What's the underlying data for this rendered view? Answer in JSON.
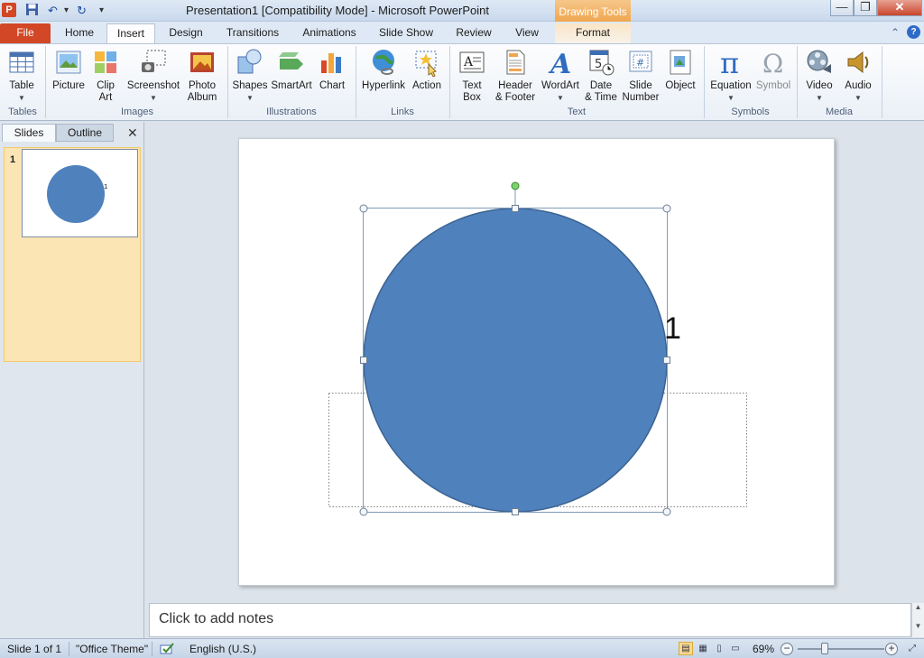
{
  "window": {
    "title": "Presentation1 [Compatibility Mode]  -  Microsoft PowerPoint",
    "app_logo": "P",
    "contextual_group": "Drawing Tools",
    "controls": {
      "minimize": "—",
      "restore": "❐",
      "close": "✕"
    }
  },
  "quick_access": {
    "save": "save-icon",
    "undo": "↶",
    "undo_dropdown": "▾",
    "redo": "↻",
    "customize": "▾"
  },
  "tabs": [
    {
      "label": "File"
    },
    {
      "label": "Home"
    },
    {
      "label": "Insert",
      "active": true
    },
    {
      "label": "Design"
    },
    {
      "label": "Transitions"
    },
    {
      "label": "Animations"
    },
    {
      "label": "Slide Show"
    },
    {
      "label": "Review"
    },
    {
      "label": "View"
    },
    {
      "label": "Format"
    }
  ],
  "ribbon": {
    "groups": {
      "tables": "Tables",
      "images": "Images",
      "illustrations": "Illustrations",
      "links": "Links",
      "text": "Text",
      "symbols": "Symbols",
      "media": "Media"
    },
    "buttons": {
      "table": "Table",
      "picture": "Picture",
      "clip_art_1": "Clip",
      "clip_art_2": "Art",
      "screenshot": "Screenshot",
      "photo_album_1": "Photo",
      "photo_album_2": "Album",
      "shapes": "Shapes",
      "smartart": "SmartArt",
      "chart": "Chart",
      "hyperlink": "Hyperlink",
      "action": "Action",
      "text_box_1": "Text",
      "text_box_2": "Box",
      "header_footer_1": "Header",
      "header_footer_2": "& Footer",
      "wordart": "WordArt",
      "date_time_1": "Date",
      "date_time_2": "& Time",
      "slide_number_1": "Slide",
      "slide_number_2": "Number",
      "object": "Object",
      "equation": "Equation",
      "symbol": "Symbol",
      "video": "Video",
      "audio": "Audio"
    },
    "glyphs": {
      "equation": "π",
      "symbol": "Ω",
      "wordart": "A",
      "date_day": "5",
      "slide_hash": "#"
    }
  },
  "left_pane": {
    "tabs": [
      "Slides",
      "Outline"
    ],
    "close": "✕",
    "slide_number": "1",
    "thumbnail_label": "1"
  },
  "slide": {
    "shape_label": "1",
    "fill_color": "#4f81bd",
    "outline_color": "#3b6391"
  },
  "notes": {
    "placeholder": "Click to add notes"
  },
  "status": {
    "slide_info": "Slide 1 of 1",
    "theme": "\"Office Theme\"",
    "language": "English (U.S.)",
    "zoom": "69%",
    "zoom_out": "−",
    "zoom_in": "+"
  }
}
